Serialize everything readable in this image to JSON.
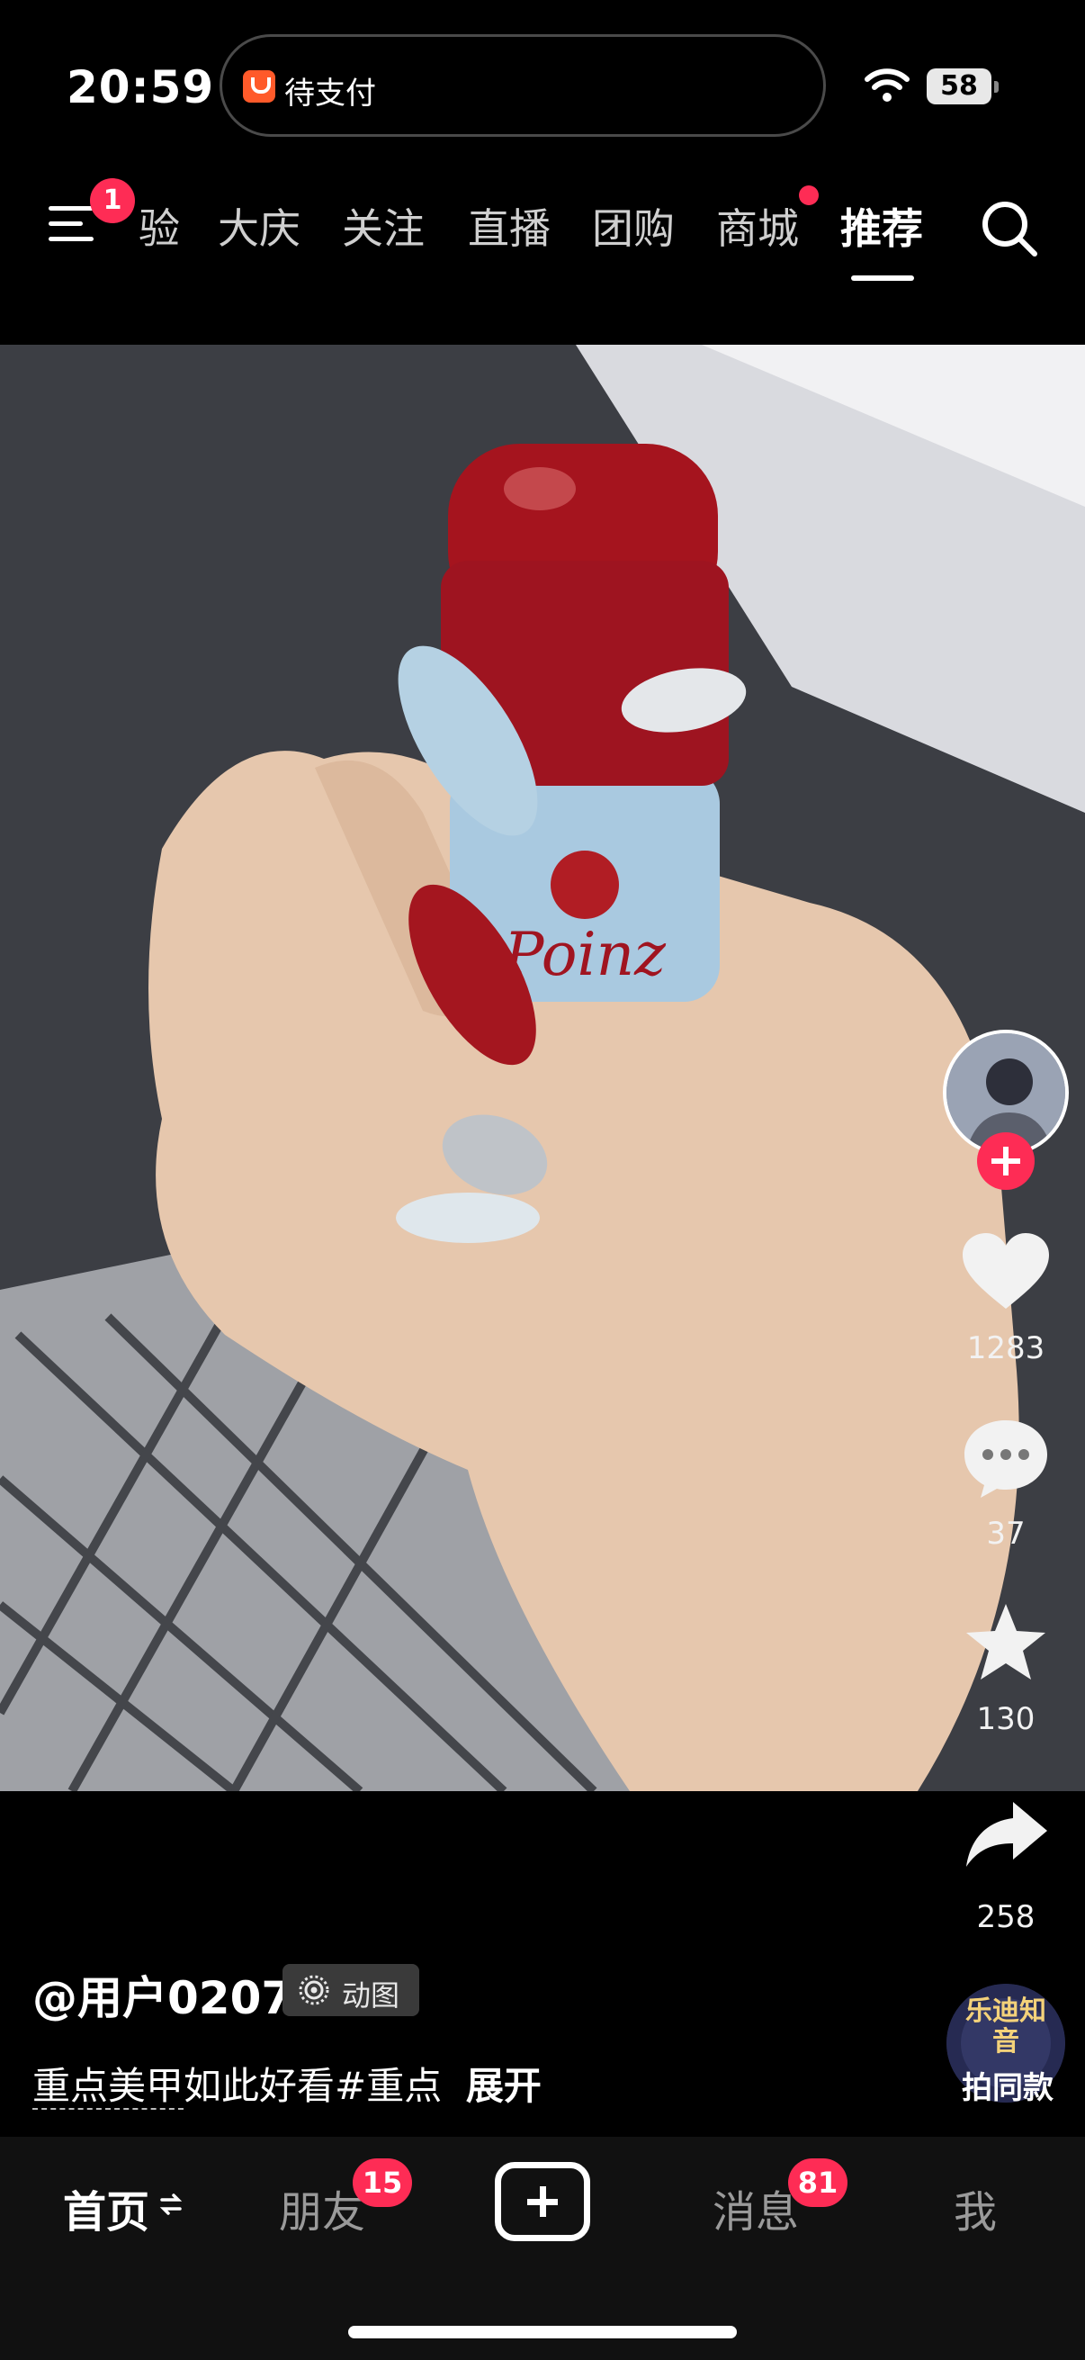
{
  "status_bar": {
    "time": "20:59",
    "pending_label": "待支付",
    "battery": "58"
  },
  "top_nav": {
    "menu_badge": "1",
    "tabs": [
      {
        "label": "验"
      },
      {
        "label": "大庆"
      },
      {
        "label": "关注"
      },
      {
        "label": "直播"
      },
      {
        "label": "团购"
      },
      {
        "label": "商城"
      },
      {
        "label": "推荐"
      }
    ],
    "active_tab": "推荐"
  },
  "video": {
    "bottle_text": "Poinz"
  },
  "side_actions": {
    "likes": "1283",
    "comments": "37",
    "favorites": "130",
    "shares": "258"
  },
  "post": {
    "author": "@用户0207",
    "tag_label": "动图",
    "caption_highlight": "重点美甲",
    "caption_text": "如此好看#重点",
    "expand_label": "展开"
  },
  "music": {
    "disc_text": "乐迪知音",
    "same_style_label": "拍同款"
  },
  "bottom_tabs": {
    "home": "首页",
    "friends": "朋友",
    "friends_badge": "15",
    "messages": "消息",
    "messages_badge": "81",
    "me": "我"
  },
  "colors": {
    "accent": "#fe2c55",
    "background": "#000000"
  }
}
